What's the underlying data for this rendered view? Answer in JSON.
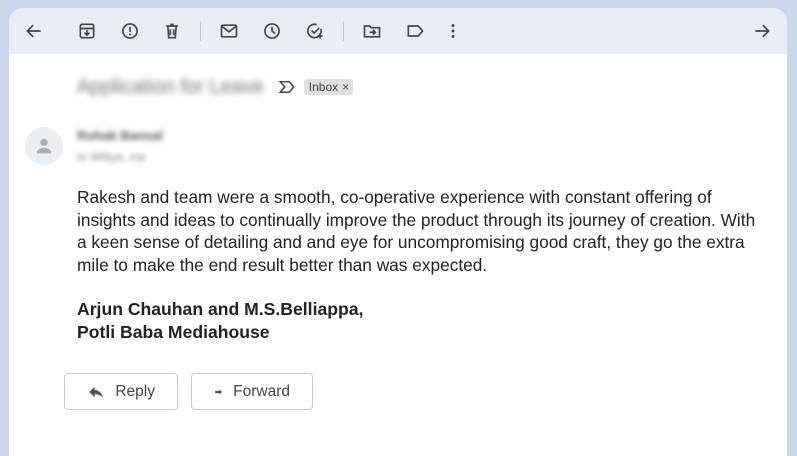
{
  "toolbar": {
    "icons": [
      "back-arrow-icon",
      "archive-icon",
      "report-spam-icon",
      "delete-icon",
      "mark-unread-icon",
      "snooze-icon",
      "add-task-icon",
      "move-to-icon",
      "labels-icon",
      "more-icon",
      "forward-arrow-icon"
    ]
  },
  "email": {
    "subject": "Application for Leave",
    "label": "Inbox",
    "label_close": "×",
    "sender_name": "Rohak Bansal",
    "sender_to": "to Witiya, me",
    "body": "Rakesh and team were a smooth, co-operative experience with constant offering of insights and ideas to continually improve the product through its journey of creation. With a keen sense of detailing and and eye for uncompromising good craft, they go the extra mile to make the end result better than was expected.",
    "signature_line1": "Arjun Chauhan and M.S.Belliappa,",
    "signature_line2": "Potli Baba Mediahouse"
  },
  "actions": {
    "reply_label": "Reply",
    "forward_label": "Forward"
  },
  "colors": {
    "background": "#c9d6ec",
    "toolbar": "#e9edf5",
    "icon": "#444746"
  }
}
